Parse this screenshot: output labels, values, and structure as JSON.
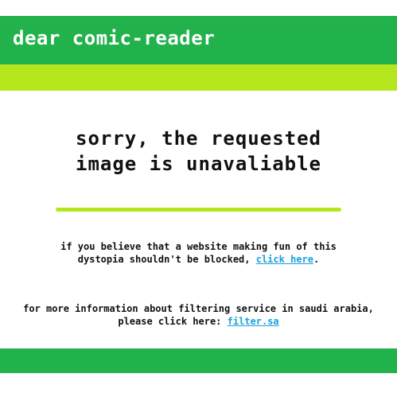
{
  "header": {
    "title": "dear comic-reader"
  },
  "main": {
    "headline_line1": "sorry, the requested",
    "headline_line2": "image is unavaliable",
    "notice": {
      "line1": "if you believe that a website making fun of this",
      "line2_prefix": "dystopia shouldn't be blocked, ",
      "link_text": "click here",
      "line2_suffix": "."
    },
    "info": {
      "line1": "for more information about filtering service in saudi arabia,",
      "line2_prefix": "please click here: ",
      "link_text": "filter.sa"
    }
  },
  "colors": {
    "green": "#22b24c",
    "lime": "#b5e61d",
    "link": "#1aa0dc"
  }
}
